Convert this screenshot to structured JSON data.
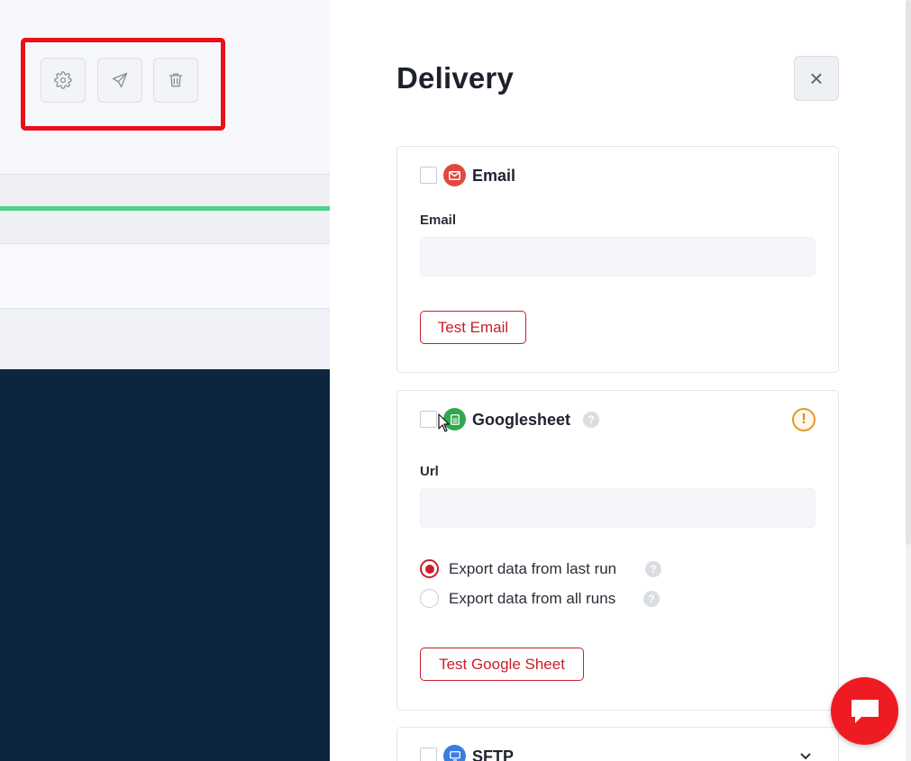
{
  "toolbar": {
    "settings_icon": "gear-icon",
    "send_icon": "send-icon",
    "delete_icon": "trash-icon"
  },
  "panel": {
    "title": "Delivery",
    "close_icon": "close-icon",
    "close_glyph": "×"
  },
  "email_section": {
    "service_name": "Email",
    "field_label": "Email",
    "field_value": "",
    "test_button": "Test Email",
    "icon": "envelope-icon",
    "icon_color": "#e2473d"
  },
  "googlesheet_section": {
    "service_name": "Googlesheet",
    "help_glyph": "?",
    "warning_glyph": "!",
    "field_label": "Url",
    "field_value": "",
    "options": [
      {
        "label": "Export data from last run",
        "selected": true
      },
      {
        "label": "Export data from all runs",
        "selected": false
      }
    ],
    "test_button": "Test Google Sheet",
    "icon": "sheet-icon",
    "icon_color": "#2fa84f"
  },
  "sftp_section": {
    "service_name": "SFTP",
    "icon": "server-icon",
    "icon_color": "#3a7ee0"
  },
  "chat": {
    "icon": "chat-icon",
    "color": "#ee1c22"
  },
  "colors": {
    "accent": "#c8202a",
    "highlight": "#e8101a",
    "dark_bg": "#0e2540",
    "progress_green": "#4fd18b"
  }
}
